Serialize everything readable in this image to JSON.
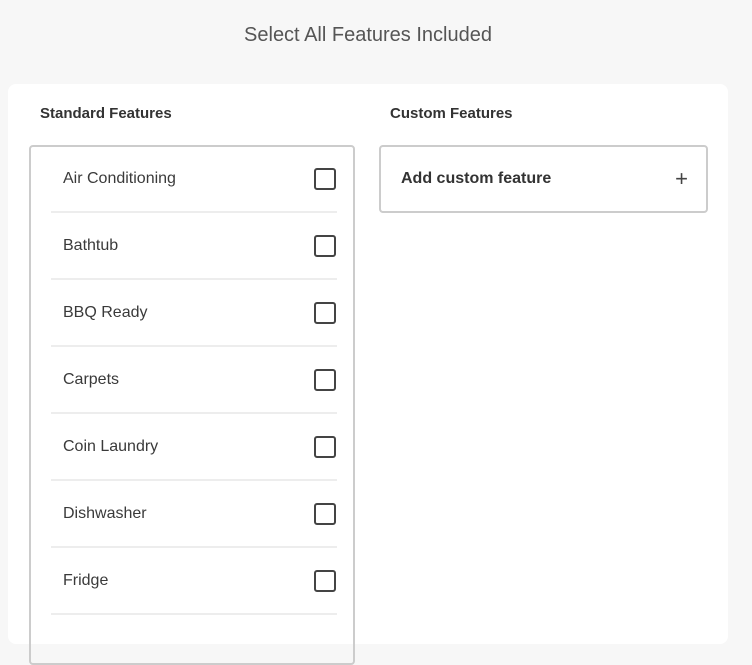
{
  "page": {
    "title": "Select All Features Included"
  },
  "standard": {
    "heading": "Standard Features",
    "items": [
      {
        "label": "Air Conditioning",
        "checked": false
      },
      {
        "label": "Bathtub",
        "checked": false
      },
      {
        "label": "BBQ Ready",
        "checked": false
      },
      {
        "label": "Carpets",
        "checked": false
      },
      {
        "label": "Coin Laundry",
        "checked": false
      },
      {
        "label": "Dishwasher",
        "checked": false
      },
      {
        "label": "Fridge",
        "checked": false
      }
    ]
  },
  "custom": {
    "heading": "Custom Features",
    "add_label": "Add custom feature",
    "add_icon": "plus-icon"
  }
}
